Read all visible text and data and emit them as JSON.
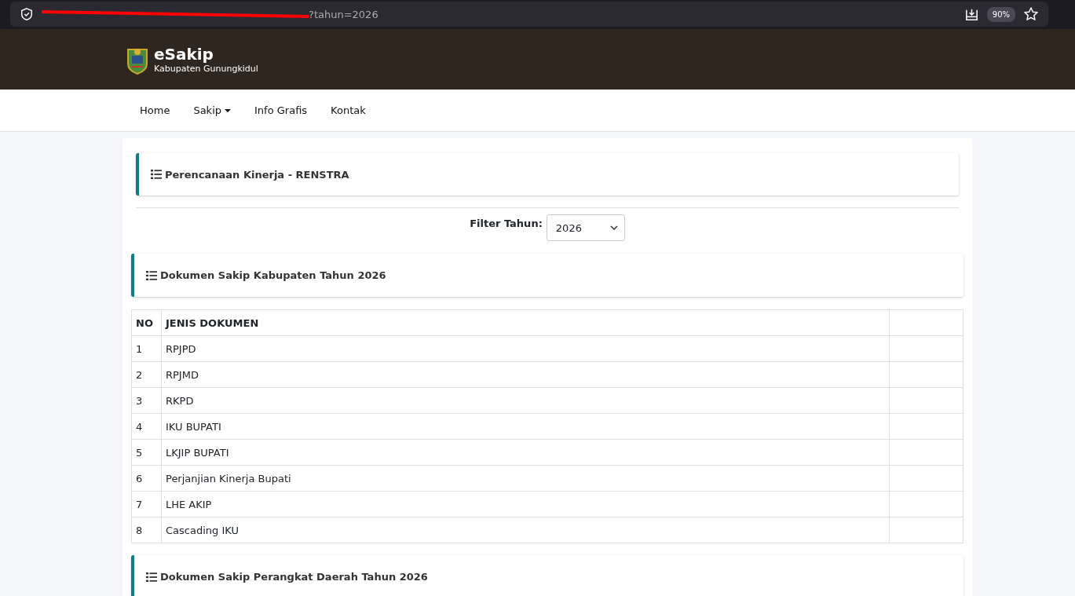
{
  "browser": {
    "url": "?tahun=2026",
    "zoom": "90%"
  },
  "header": {
    "title": "eSakip",
    "subtitle": "Kabupaten Gunungkidul"
  },
  "nav": [
    {
      "label": "Home",
      "kind": "link"
    },
    {
      "label": "Sakip",
      "kind": "dropdown"
    },
    {
      "label": "Info Grafis",
      "kind": "link"
    },
    {
      "label": "Kontak",
      "kind": "link"
    }
  ],
  "page_title": "Perencanaan Kinerja - RENSTRA",
  "filter": {
    "label": "Filter Tahun:",
    "value": "2026"
  },
  "section_kabupaten": {
    "title": "Dokumen Sakip Kabupaten Tahun 2026"
  },
  "table": {
    "columns": [
      "NO",
      "JENIS DOKUMEN"
    ],
    "rows": [
      {
        "no": "1",
        "name": "RPJPD"
      },
      {
        "no": "2",
        "name": "RPJMD"
      },
      {
        "no": "3",
        "name": "RKPD"
      },
      {
        "no": "4",
        "name": "IKU BUPATI"
      },
      {
        "no": "5",
        "name": "LKJIP BUPATI"
      },
      {
        "no": "6",
        "name": "Perjanjian Kinerja Bupati"
      },
      {
        "no": "7",
        "name": "LHE AKIP"
      },
      {
        "no": "8",
        "name": "Cascading IKU"
      }
    ]
  },
  "section_perangkat": {
    "title": "Dokumen Sakip Perangkat Daerah Tahun 2026"
  }
}
